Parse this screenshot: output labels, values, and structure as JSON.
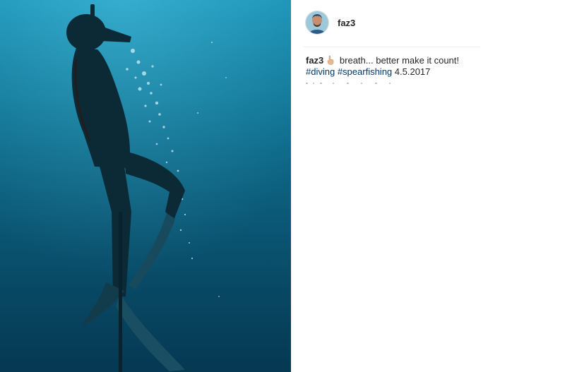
{
  "post": {
    "photo": {
      "description_icon": "photo-image"
    },
    "author": {
      "username": "faz3",
      "avatar_icon": "user-avatar-icon"
    },
    "caption": {
      "username": "faz3",
      "emoji_icon": "pointing-up-hand-emoji-icon",
      "text": " breath... better make it count!",
      "hashtags": [
        "#diving",
        "#spearfishing"
      ],
      "date": "4.5.2017"
    }
  },
  "colors": {
    "water_top": "#1a90b3",
    "water_bottom": "#084867",
    "hashtag": "#00376b",
    "text": "#262626"
  }
}
